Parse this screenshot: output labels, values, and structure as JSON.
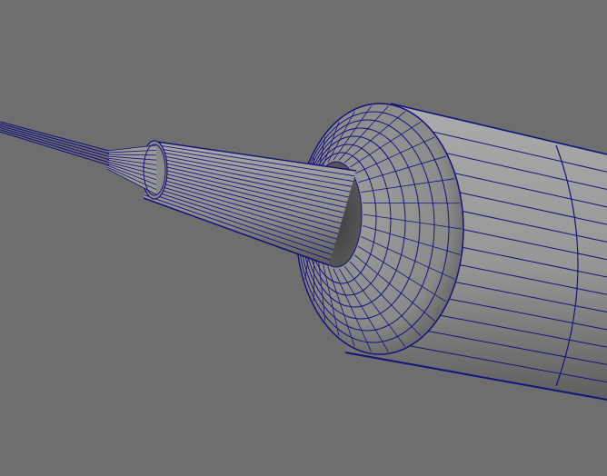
{
  "viewport": {
    "background_color": "#6e6e6e",
    "wireframe_color": "#14147a",
    "shade_light": "#a4a4a4",
    "shade_mid": "#8c8c8c",
    "shade_dark": "#4c4c4c"
  },
  "scene": {
    "objects": [
      {
        "name": "wire",
        "kind": "thin-cylinder"
      },
      {
        "name": "cable-ferrule",
        "kind": "small-cone"
      },
      {
        "name": "tapered-nozzle",
        "kind": "cone"
      },
      {
        "name": "rounded-cap",
        "kind": "torus-fillet"
      },
      {
        "name": "main-body",
        "kind": "cylinder"
      }
    ]
  }
}
